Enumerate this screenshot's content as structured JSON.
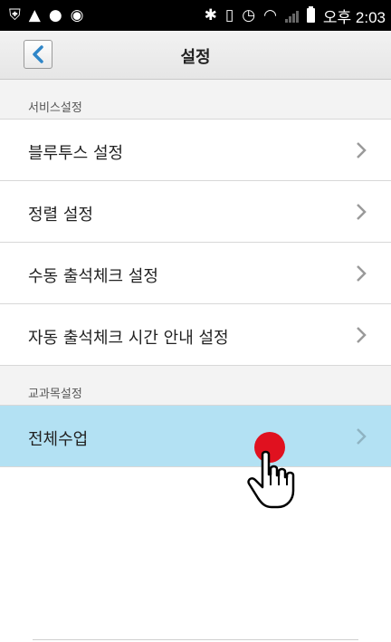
{
  "status_bar": {
    "time": "오후 2:03",
    "left_icons": [
      "shield-icon",
      "warning-icon",
      "circle-icon",
      "sync-icon"
    ],
    "right_icons": [
      "bluetooth-icon",
      "vibrate-icon",
      "alarm-icon",
      "wifi-icon",
      "signal-icon",
      "battery-icon"
    ]
  },
  "header": {
    "title": "설정",
    "back_icon": "chevron-left-icon"
  },
  "sections": [
    {
      "title": "서비스설정",
      "items": [
        {
          "label": "블루투스 설정"
        },
        {
          "label": "정렬 설정"
        },
        {
          "label": "수동 출석체크 설정"
        },
        {
          "label": "자동 출석체크 시간 안내 설정"
        }
      ]
    },
    {
      "title": "교과목설정",
      "items": [
        {
          "label": "전체수업",
          "active": true
        }
      ]
    }
  ],
  "colors": {
    "active_row": "#b3e1f3",
    "accent": "#2f86c8",
    "touch_dot": "#e0111f"
  }
}
